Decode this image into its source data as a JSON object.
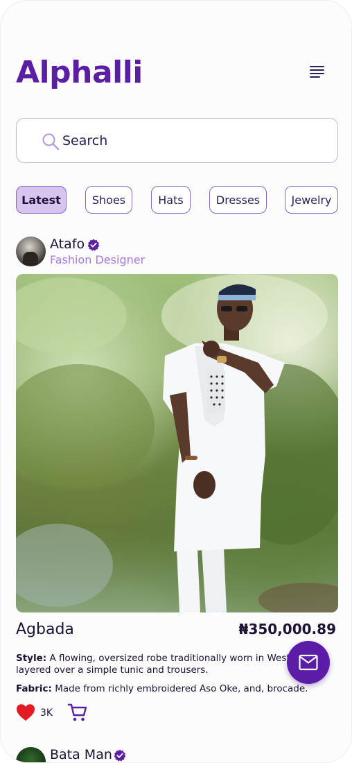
{
  "app": {
    "title": "Alphalli"
  },
  "search": {
    "placeholder": "Search"
  },
  "categories": [
    {
      "label": "Latest",
      "active": true
    },
    {
      "label": "Shoes",
      "active": false
    },
    {
      "label": "Hats",
      "active": false
    },
    {
      "label": "Dresses",
      "active": false
    },
    {
      "label": "Jewelry",
      "active": false
    }
  ],
  "post": {
    "author": "Atafo",
    "role": "Fashion Designer",
    "verified": true,
    "image_alt": "man-in-white-agbada-photo",
    "title": "Agbada",
    "price": "₦350,000.89",
    "style_label": "Style:",
    "style_text": "A flowing, oversized robe traditionally worn in West Afri layered over a simple tunic and trousers.",
    "fabric_label": "Fabric:",
    "fabric_text": "Made from richly embroidered Aso Oke, and, brocade.",
    "likes": "3K"
  },
  "next_post": {
    "author": "Bata Man",
    "verified": true
  },
  "colors": {
    "brand": "#5a1fa3",
    "chip_active_bg": "#d7c4ef",
    "role_text": "#a77bdb",
    "heart": "#e31b23",
    "fab_bg": "#5b1ca8"
  },
  "icons": {
    "menu": "menu-icon",
    "search": "search-icon",
    "verified": "verified-badge-icon",
    "heart": "heart-icon",
    "cart": "cart-icon",
    "mail": "mail-icon"
  }
}
